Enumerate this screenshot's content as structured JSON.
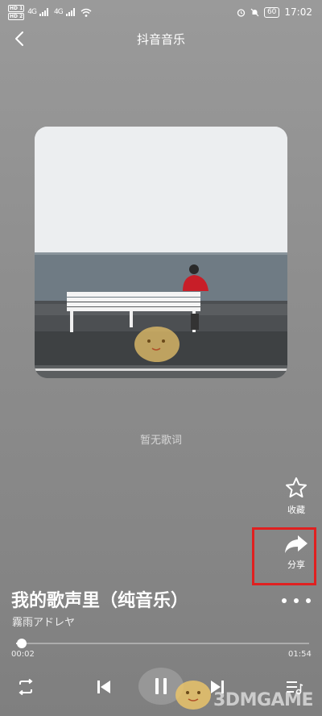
{
  "status_bar": {
    "sim1_label": "HD 1",
    "sim2_label": "HD 2",
    "signal1": "4G",
    "signal2": "4G",
    "battery": "60",
    "time": "17:02"
  },
  "header": {
    "title": "抖音音乐",
    "back_icon": "chevron-left-icon"
  },
  "lyrics": {
    "placeholder": "暂无歌词"
  },
  "actions": {
    "favorite_label": "收藏",
    "favorite_icon": "star-outline-icon",
    "share_label": "分享",
    "share_icon": "share-arrow-icon",
    "highlight_color": "#e02020"
  },
  "song": {
    "title": "我的歌声里（纯音乐）",
    "artist": "霧雨アドレヤ"
  },
  "player": {
    "current_time": "00:02",
    "total_time": "01:54",
    "progress_fraction": 0.02,
    "state": "playing"
  },
  "watermark": {
    "text": "3DMGAME"
  }
}
